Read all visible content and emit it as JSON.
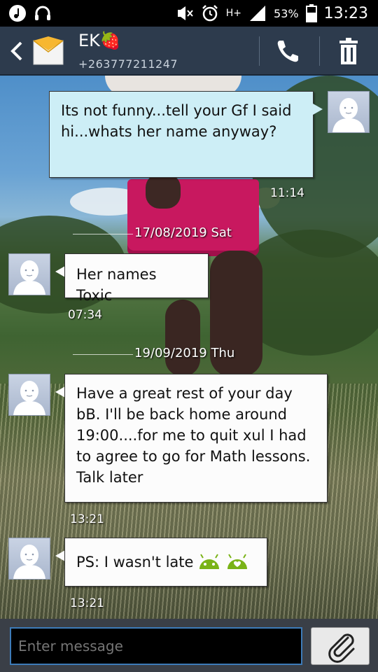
{
  "status_bar": {
    "left_icons": [
      "music-icon",
      "headset-icon"
    ],
    "right_icons": [
      "mute-icon",
      "alarm-icon",
      "hplus-signal-icon",
      "signal-icon",
      "battery-icon"
    ],
    "network": "H+",
    "battery": "53%",
    "time": "13:23"
  },
  "header": {
    "contact_name": "EK🍓",
    "contact_number": "+263777211247",
    "icons": [
      "back-icon",
      "envelope-icon",
      "phone-icon",
      "trash-icon"
    ]
  },
  "messages": [
    {
      "direction": "outgoing",
      "text": "Its not funny...tell your Gf  I said hi...whats her name anyway?",
      "time": "11:14"
    },
    {
      "type": "date",
      "label": "17/08/2019 Sat"
    },
    {
      "direction": "incoming",
      "text": "Her names Toxic",
      "time": "07:34"
    },
    {
      "type": "date",
      "label": "19/09/2019 Thu"
    },
    {
      "direction": "incoming",
      "text": "Have a great rest of your day bB. I'll be back home around 19:00....for me to quit xul I had to agree to go for Math lessons. Talk later",
      "time": "13:21"
    },
    {
      "direction": "incoming",
      "text": "PS: I wasn't late",
      "emoji_icons": [
        "android-icon",
        "android-heart-icon"
      ],
      "time": "13:21"
    }
  ],
  "composer": {
    "placeholder": "Enter message",
    "icons": [
      "paperclip-icon"
    ]
  },
  "colors": {
    "action_bar": "#2d3b4d",
    "outgoing_bubble": "#cdeef6",
    "incoming_bubble": "#fcfcfc",
    "input_border": "#3d7bb8",
    "android_green": "#7ab317"
  }
}
